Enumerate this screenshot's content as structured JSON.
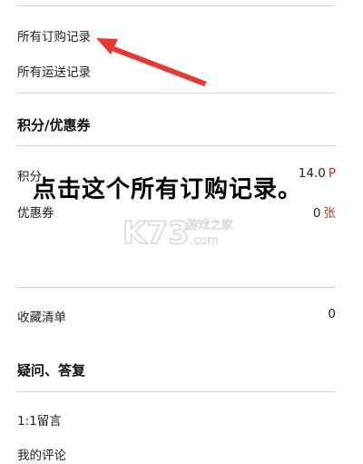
{
  "orders": {
    "all_orders_label": "所有订购记录",
    "all_shipping_label": "所有运送记录"
  },
  "points_coupons": {
    "heading": "积分/优惠券",
    "points_label": "积分",
    "points_value": "14.0",
    "points_unit": "P",
    "coupons_label": "优惠券",
    "coupons_value": "0",
    "coupons_unit": "张"
  },
  "wishlist": {
    "label": "收藏清单",
    "count": "0"
  },
  "qa": {
    "heading": "疑问、答复",
    "message_label": "1:1留言",
    "reviews_label": "我的评论"
  },
  "annotation": {
    "instruction": "点击这个所有订购记录。",
    "arrow_color": "#e53935"
  },
  "watermark": {
    "text_top": "游戏之家",
    "text_bottom": ".com"
  }
}
